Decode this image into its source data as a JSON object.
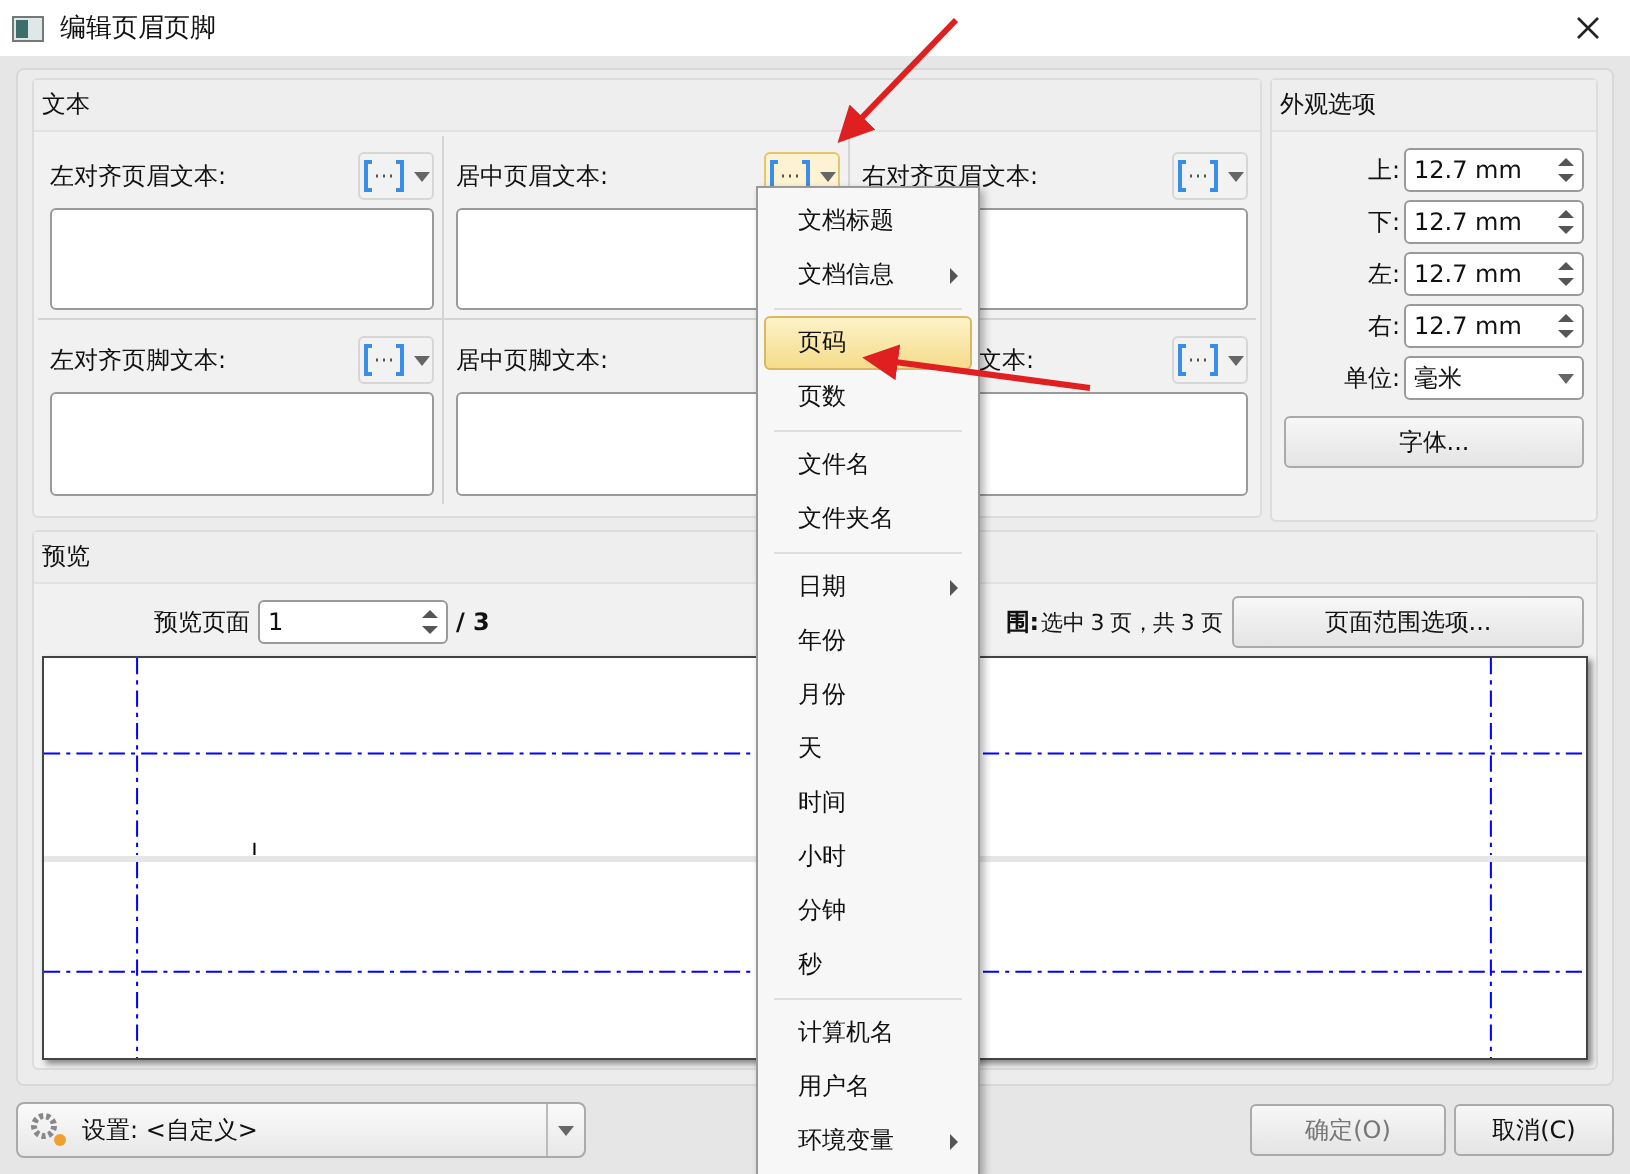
{
  "window": {
    "title": "编辑页眉页脚"
  },
  "text_group": {
    "title": "文本",
    "cells": [
      {
        "label": "左对齐页眉文本:",
        "pressed": false
      },
      {
        "label": "居中页眉文本:",
        "pressed": true
      },
      {
        "label": "右对齐页眉文本:",
        "pressed": false
      },
      {
        "label": "左对齐页脚文本:",
        "pressed": false
      },
      {
        "label": "居中页脚文本:"
      },
      {
        "label": "文本:",
        "pressed": false
      }
    ]
  },
  "appearance": {
    "title": "外观选项",
    "margins": [
      {
        "label": "上:",
        "value": "12.7 mm"
      },
      {
        "label": "下:",
        "value": "12.7 mm"
      },
      {
        "label": "左:",
        "value": "12.7 mm"
      },
      {
        "label": "右:",
        "value": "12.7 mm"
      }
    ],
    "unit": {
      "label": "单位:",
      "value": "毫米"
    },
    "font_button": "字体..."
  },
  "preview": {
    "title": "预览",
    "page_label": "预览页面",
    "page_value": "1",
    "page_total": "/ 3",
    "range_label": "围:",
    "range_text": "选中 3 页，共 3 页",
    "range_button": "页面范围选项..."
  },
  "menu": {
    "items": [
      {
        "kind": "item",
        "label": "文档标题",
        "submenu": false,
        "selected": false
      },
      {
        "kind": "item",
        "label": "文档信息",
        "submenu": true,
        "selected": false
      },
      {
        "kind": "separator"
      },
      {
        "kind": "item",
        "label": "页码",
        "submenu": false,
        "selected": true
      },
      {
        "kind": "item",
        "label": "页数",
        "submenu": false,
        "selected": false
      },
      {
        "kind": "separator"
      },
      {
        "kind": "item",
        "label": "文件名",
        "submenu": false,
        "selected": false
      },
      {
        "kind": "item",
        "label": "文件夹名",
        "submenu": false,
        "selected": false
      },
      {
        "kind": "separator"
      },
      {
        "kind": "item",
        "label": "日期",
        "submenu": true,
        "selected": false
      },
      {
        "kind": "item",
        "label": "年份",
        "submenu": false,
        "selected": false
      },
      {
        "kind": "item",
        "label": "月份",
        "submenu": false,
        "selected": false
      },
      {
        "kind": "item",
        "label": "天",
        "submenu": false,
        "selected": false
      },
      {
        "kind": "item",
        "label": "时间",
        "submenu": false,
        "selected": false
      },
      {
        "kind": "item",
        "label": "小时",
        "submenu": false,
        "selected": false
      },
      {
        "kind": "item",
        "label": "分钟",
        "submenu": false,
        "selected": false
      },
      {
        "kind": "item",
        "label": "秒",
        "submenu": false,
        "selected": false
      },
      {
        "kind": "separator"
      },
      {
        "kind": "item",
        "label": "计算机名",
        "submenu": false,
        "selected": false
      },
      {
        "kind": "item",
        "label": "用户名",
        "submenu": false,
        "selected": false
      },
      {
        "kind": "item",
        "label": "环境变量",
        "submenu": true,
        "selected": false
      }
    ]
  },
  "footer": {
    "settings": "设置: <自定义>",
    "ok": "确定(O)",
    "cancel": "取消(C)"
  }
}
